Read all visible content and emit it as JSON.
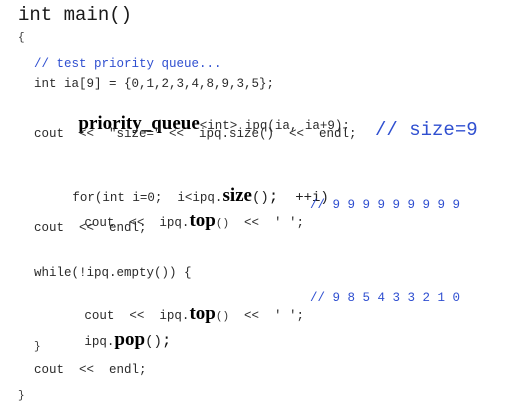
{
  "code": {
    "l1": "int main()",
    "l2": "{",
    "l3_comment": "// test priority queue...",
    "l4": "int ia[9] = {0,1,2,3,4,8,9,3,5};",
    "l5_kw": "priority_queue",
    "l5_tmpl": "<int>",
    "l5_rest": " ipq(ia, ia+9);",
    "l6": "cout  <<  \"size=\" <<  ipq.size()  <<  endl;",
    "l6_comment": "// size=9",
    "l7_a": "for(int i=0;  i<ipq.",
    "l7_kw": "size",
    "l7_b": "()",
    "l7_semi": ";",
    "l7_c": "  ++i)",
    "l8_a": "cout  <<  ipq.",
    "l8_kw": "top",
    "l8_b": "()",
    "l8_c": "  <<  ' ';",
    "l8_comment": "// 9 9 9 9 9 9 9 9 9",
    "l9": "cout  <<  endl;",
    "l10_a": "while(!ipq.empty()) {",
    "l11_a": "cout  <<  ipq.",
    "l11_kw": "top",
    "l11_b": "()",
    "l11_c": "  <<  ' ';",
    "l11_comment": "// 9 8 5 4 3 3 2 1 0",
    "l12_a": "ipq.",
    "l12_kw": "pop",
    "l12_b": "()",
    "l12_semi": ";",
    "l13": "}",
    "l14": "cout  <<  endl;",
    "l15": "}"
  },
  "colors": {
    "comment": "#2f4fd0",
    "text": "#1a1a1a"
  }
}
